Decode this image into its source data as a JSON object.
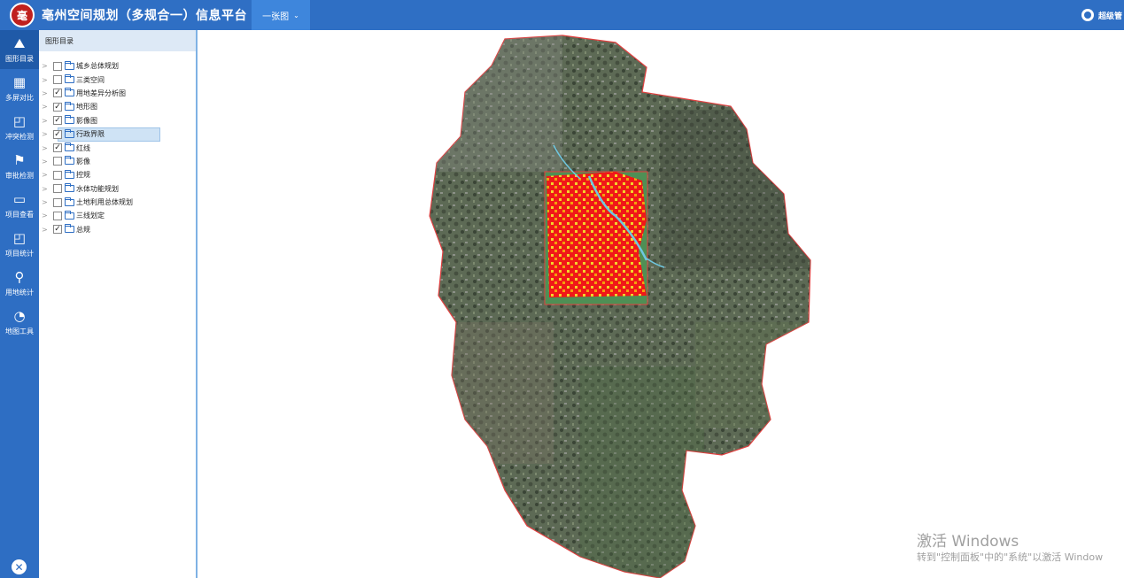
{
  "header": {
    "logo_text": "毫",
    "title": "亳州空间规划（多规合一）信息平台",
    "view_tab": "一张图",
    "user_name": "超级管"
  },
  "leftnav": [
    {
      "label": "图形目录",
      "icon": "map-icon",
      "glyph": "⛰"
    },
    {
      "label": "多屏对比",
      "icon": "grid-icon",
      "glyph": "▦"
    },
    {
      "label": "冲突检测",
      "icon": "search-window-icon",
      "glyph": "◰"
    },
    {
      "label": "审批检测",
      "icon": "flag-icon",
      "glyph": "⚑"
    },
    {
      "label": "项目查看",
      "icon": "monitor-icon",
      "glyph": "▭"
    },
    {
      "label": "项目统计",
      "icon": "folder-search-icon",
      "glyph": "◰"
    },
    {
      "label": "用地统计",
      "icon": "magnifier-icon",
      "glyph": "⚲"
    },
    {
      "label": "地图工具",
      "icon": "pie-chart-icon",
      "glyph": "◔"
    }
  ],
  "panel": {
    "title": "图形目录",
    "items": [
      {
        "label": "城乡总体规划",
        "checked": false
      },
      {
        "label": "三类空间",
        "checked": false
      },
      {
        "label": "用地差异分析图",
        "checked": true
      },
      {
        "label": "地形图",
        "checked": true
      },
      {
        "label": "影像图",
        "checked": true
      },
      {
        "label": "行政界限",
        "checked": true
      },
      {
        "label": "红线",
        "checked": true
      },
      {
        "label": "影像",
        "checked": false
      },
      {
        "label": "控规",
        "checked": false
      },
      {
        "label": "水体功能规划",
        "checked": false
      },
      {
        "label": "土地利用总体规划",
        "checked": false
      },
      {
        "label": "三线划定",
        "checked": false
      },
      {
        "label": "总规",
        "checked": true
      }
    ],
    "selected_item": "行政界限"
  },
  "watermark": {
    "line1": "激活 Windows",
    "line2": "转到\"控制面板\"中的\"系统\"以激活 Window"
  },
  "colors": {
    "header": "#2f6fc4",
    "leftnav": "#2e6ec3",
    "boundary": "#e04040",
    "planning_red": "#f01818",
    "planning_yellow": "#f3d42a"
  }
}
